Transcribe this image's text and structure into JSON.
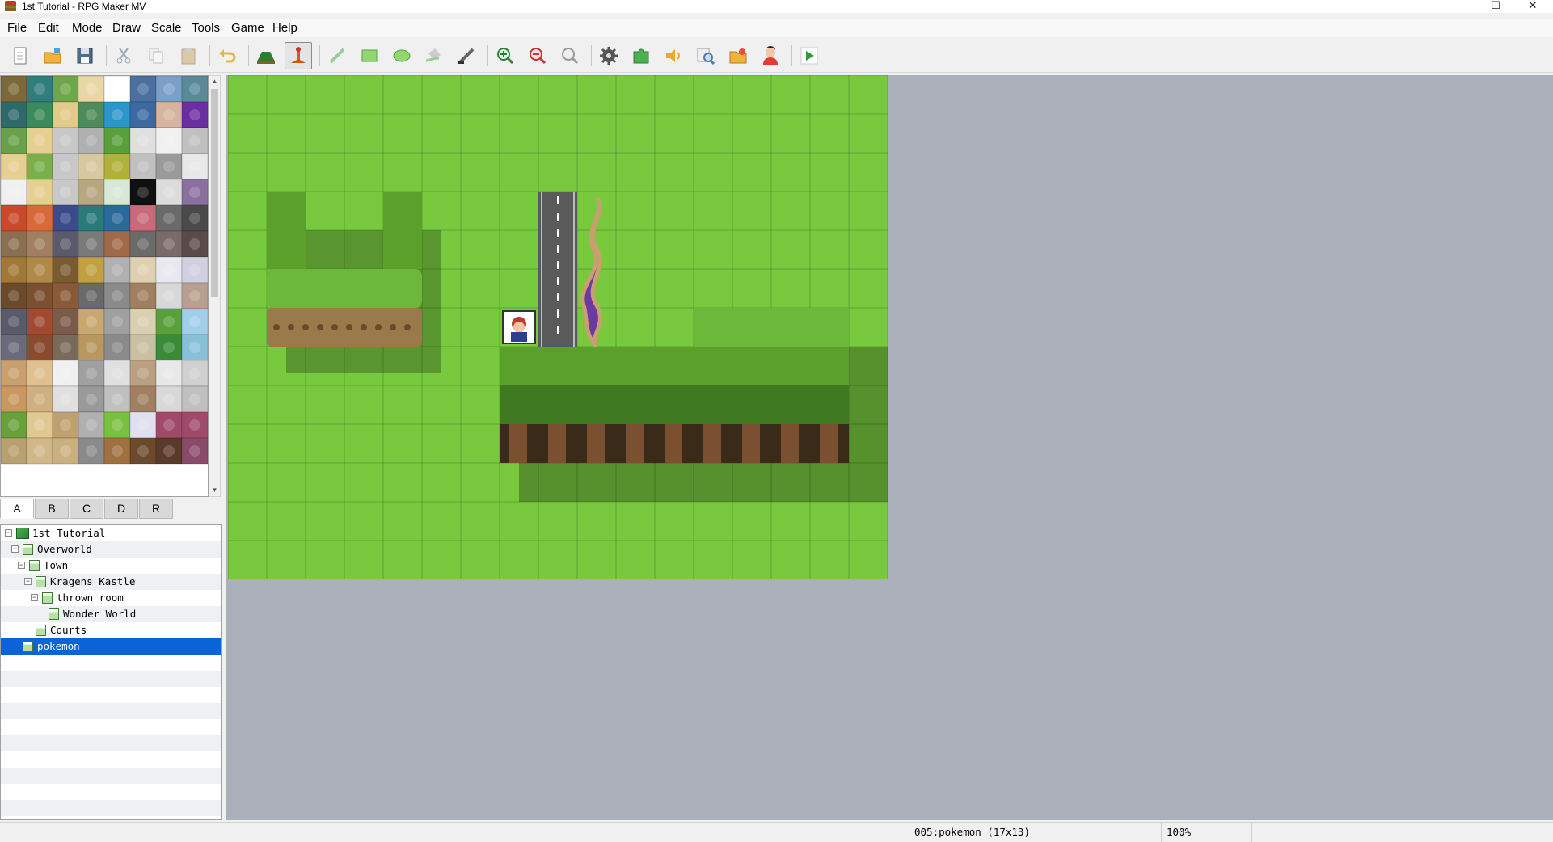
{
  "window": {
    "title": "1st Tutorial - RPG Maker MV",
    "minimize": "—",
    "maximize": "☐",
    "close": "✕"
  },
  "menu": [
    "File",
    "Edit",
    "Mode",
    "Draw",
    "Scale",
    "Tools",
    "Game",
    "Help"
  ],
  "toolbar": {
    "buttons": [
      {
        "name": "new-project-icon",
        "group": 0
      },
      {
        "name": "open-project-icon",
        "group": 0
      },
      {
        "name": "save-project-icon",
        "group": 0
      },
      {
        "name": "cut-icon",
        "group": 1
      },
      {
        "name": "copy-icon",
        "group": 1
      },
      {
        "name": "paste-icon",
        "group": 1
      },
      {
        "name": "undo-icon",
        "group": 2
      },
      {
        "name": "map-mode-icon",
        "group": 3
      },
      {
        "name": "event-mode-icon",
        "group": 3,
        "active": true
      },
      {
        "name": "pencil-icon",
        "group": 4
      },
      {
        "name": "rectangle-icon",
        "group": 4
      },
      {
        "name": "ellipse-icon",
        "group": 4
      },
      {
        "name": "flood-fill-icon",
        "group": 4
      },
      {
        "name": "shadow-pen-icon",
        "group": 4
      },
      {
        "name": "zoom-in-icon",
        "group": 5
      },
      {
        "name": "zoom-out-icon",
        "group": 5
      },
      {
        "name": "actual-size-icon",
        "group": 5
      },
      {
        "name": "database-icon",
        "group": 6
      },
      {
        "name": "plugin-manager-icon",
        "group": 6
      },
      {
        "name": "sound-test-icon",
        "group": 6
      },
      {
        "name": "event-searcher-icon",
        "group": 6
      },
      {
        "name": "resource-manager-icon",
        "group": 6
      },
      {
        "name": "character-generator-icon",
        "group": 6
      },
      {
        "name": "playtest-icon",
        "group": 7
      }
    ]
  },
  "tileset_tabs": [
    {
      "label": "A",
      "active": true
    },
    {
      "label": "B"
    },
    {
      "label": "C"
    },
    {
      "label": "D"
    },
    {
      "label": "R"
    }
  ],
  "map_tree": [
    {
      "label": "1st Tutorial",
      "depth": 0,
      "toggle": true,
      "root": true
    },
    {
      "label": "Overworld",
      "depth": 1,
      "toggle": true
    },
    {
      "label": "Town",
      "depth": 2,
      "toggle": true
    },
    {
      "label": "Kragens Kastle",
      "depth": 3,
      "toggle": true
    },
    {
      "label": "thrown room",
      "depth": 4,
      "toggle": true
    },
    {
      "label": "Wonder World",
      "depth": 5
    },
    {
      "label": "Courts",
      "depth": 3
    },
    {
      "label": "pokemon",
      "depth": 1,
      "selected": true
    }
  ],
  "map": {
    "cols": 17,
    "rows": 13,
    "event": {
      "name": "player-event-icon",
      "col": 7,
      "row": 6
    }
  },
  "status": {
    "map_info": "005:pokemon (17x13)",
    "zoom": "100%"
  },
  "colors": {
    "grass": "#79c93f",
    "selection": "#0a64d8",
    "map_background": "#abb0ba"
  }
}
